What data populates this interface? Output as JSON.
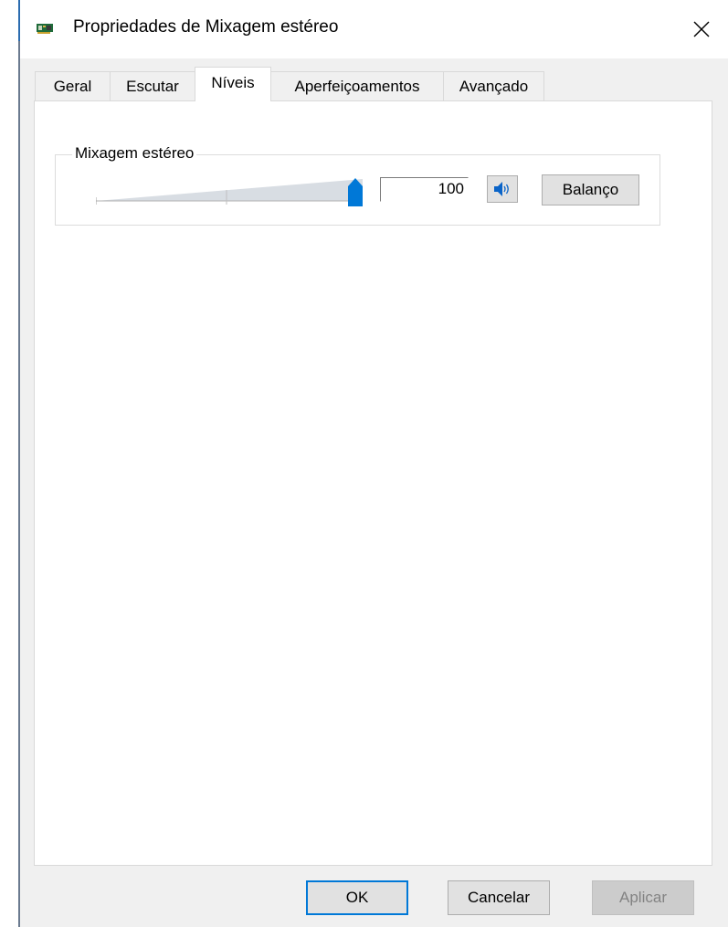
{
  "window": {
    "title": "Propriedades de Mixagem estéreo",
    "icon": "sound-card-icon",
    "close_icon": "close-icon"
  },
  "tabs": [
    {
      "label": "Geral",
      "active": false
    },
    {
      "label": "Escutar",
      "active": false
    },
    {
      "label": "Níveis",
      "active": true
    },
    {
      "label": "Aperfeiçoamentos",
      "active": false
    },
    {
      "label": "Avançado",
      "active": false
    }
  ],
  "levels": {
    "group_label": "Mixagem estéreo",
    "volume_value": "100",
    "volume_fraction": 1.0,
    "mute_icon": "speaker-icon",
    "balance_label": "Balanço"
  },
  "buttons": {
    "ok": "OK",
    "cancel": "Cancelar",
    "apply": "Aplicar"
  },
  "colors": {
    "accent": "#0078d7",
    "window_bg": "#f0f0f0",
    "panel_bg": "#ffffff"
  }
}
